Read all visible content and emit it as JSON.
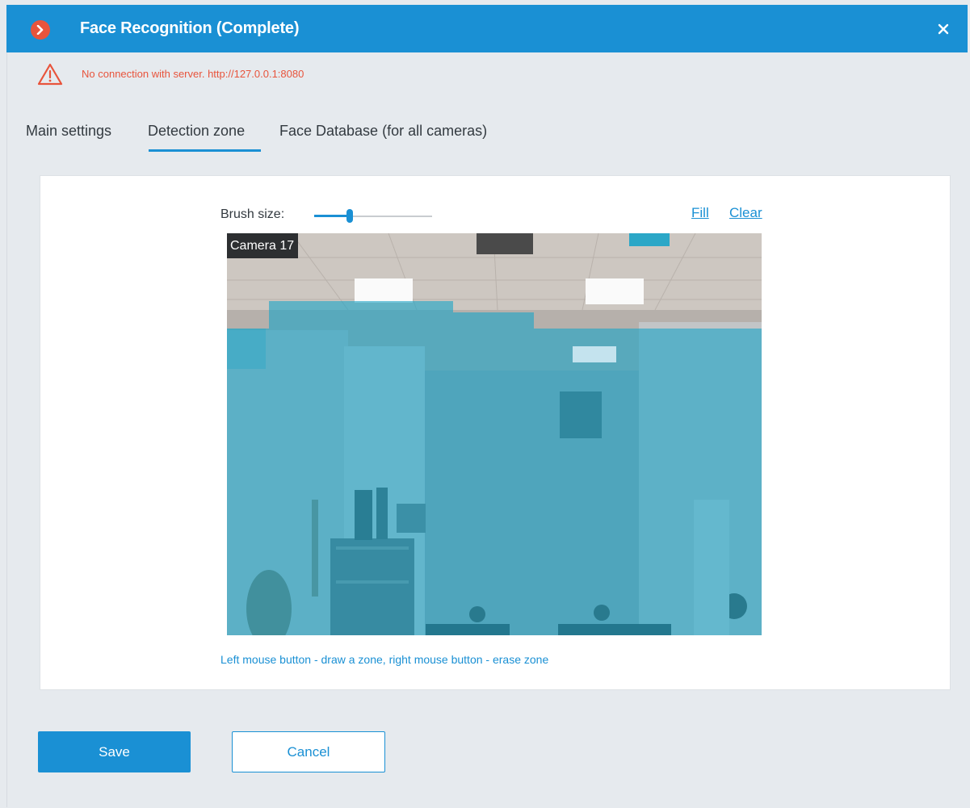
{
  "window": {
    "title": "Face Recognition (Complete)",
    "accent_color": "#1a90d4"
  },
  "alert": {
    "icon": "warning-triangle-icon",
    "message": "No connection with server. http://127.0.0.1:8080",
    "color": "#e8543c"
  },
  "tabs": [
    {
      "label": "Main settings",
      "active": false
    },
    {
      "label": "Detection zone",
      "active": true
    },
    {
      "label": "Face Database (for all cameras)",
      "active": false
    }
  ],
  "zone_editor": {
    "brush_label": "Brush size:",
    "brush_level": 0.3,
    "fill_label": "Fill",
    "clear_label": "Clear",
    "camera_name": "Camera 17",
    "zone_color": "#1fa5c6",
    "hint": "Left mouse button - draw a zone, right mouse button - erase zone"
  },
  "footer": {
    "save_label": "Save",
    "cancel_label": "Cancel"
  }
}
